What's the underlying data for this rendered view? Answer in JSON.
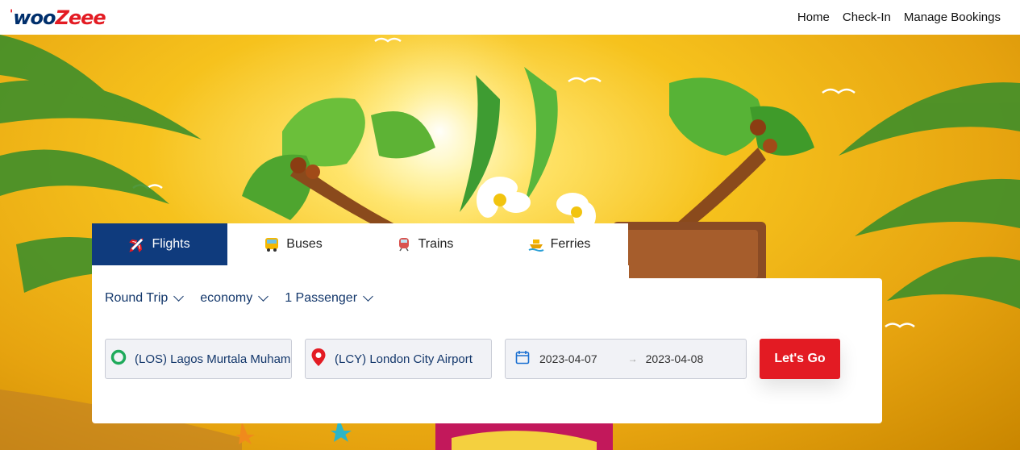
{
  "header": {
    "logo": {
      "dot": "'",
      "part1": "woo",
      "part2": "Zeee"
    },
    "nav": [
      {
        "label": "Home"
      },
      {
        "label": "Check-In"
      },
      {
        "label": "Manage Bookings"
      }
    ]
  },
  "tabs": [
    {
      "label": "Flights",
      "icon": "airplane-icon",
      "active": true
    },
    {
      "label": "Buses",
      "icon": "bus-icon",
      "active": false
    },
    {
      "label": "Trains",
      "icon": "train-icon",
      "active": false
    },
    {
      "label": "Ferries",
      "icon": "ferry-icon",
      "active": false
    }
  ],
  "search": {
    "trip_type": "Round Trip",
    "cabin_class": "economy",
    "passengers": "1 Passenger",
    "origin": "(LOS) Lagos Murtala Muhammed",
    "destination": "(LCY) London City Airport",
    "depart_date": "2023-04-07",
    "return_date": "2023-04-08",
    "submit_label": "Let's Go"
  },
  "colors": {
    "brand_navy": "#0f3b7d",
    "brand_red": "#e31b23",
    "origin_marker": "#1faa5b",
    "dest_marker": "#e31b23"
  }
}
